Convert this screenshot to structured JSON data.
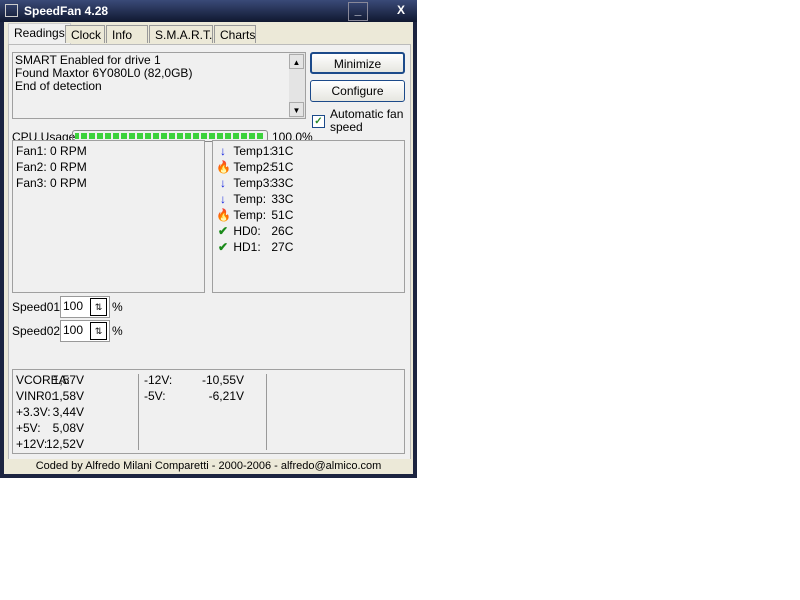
{
  "window": {
    "title": "SpeedFan 4.28",
    "minimize": "_",
    "close": "X"
  },
  "tabs": [
    {
      "label": "Readings"
    },
    {
      "label": "Clock"
    },
    {
      "label": "Info"
    },
    {
      "label": "S.M.A.R.T."
    },
    {
      "label": "Charts"
    }
  ],
  "log": [
    "SMART Enabled for drive 1",
    "Found Maxtor 6Y080L0 (82,0GB)",
    "End of detection"
  ],
  "buttons": {
    "minimize": "Minimize",
    "configure": "Configure"
  },
  "auto_fan": {
    "label_1": "Automatic fan",
    "label_2": "speed",
    "checked": true
  },
  "cpu": {
    "label": "CPU Usage",
    "value_text": "100,0%",
    "percent": 100
  },
  "fans": [
    "Fan1: 0 RPM",
    "Fan2: 0 RPM",
    "Fan3: 0 RPM"
  ],
  "temps": [
    {
      "icon": "arrow-down-icon",
      "label": "Temp1:",
      "value": "31C"
    },
    {
      "icon": "fire-icon",
      "label": "Temp2:",
      "value": "51C"
    },
    {
      "icon": "arrow-down-icon",
      "label": "Temp3:",
      "value": "33C"
    },
    {
      "icon": "arrow-down-icon",
      "label": "Temp:",
      "value": "33C"
    },
    {
      "icon": "fire-icon",
      "label": "Temp:",
      "value": "51C"
    },
    {
      "icon": "check-icon",
      "label": "HD0:",
      "value": "26C"
    },
    {
      "icon": "check-icon",
      "label": "HD1:",
      "value": "27C"
    }
  ],
  "speeds": [
    {
      "label": "Speed01:",
      "value": "100",
      "unit": "%"
    },
    {
      "label": "Speed02:",
      "value": "100",
      "unit": "%"
    }
  ],
  "volts_col1": [
    {
      "label": "VCOREA:",
      "value": "1,57V"
    },
    {
      "label": "VINR0:",
      "value": "1,58V"
    },
    {
      "label": "+3.3V:",
      "value": "3,44V"
    },
    {
      "label": "+5V:",
      "value": "5,08V"
    },
    {
      "label": "+12V:",
      "value": "12,52V"
    }
  ],
  "volts_col2": [
    {
      "label": "-12V:",
      "value": "-10,55V"
    },
    {
      "label": "-5V:",
      "value": "-6,21V"
    }
  ],
  "status": "Coded by Alfredo Milani Comparetti - 2000-2006 - alfredo@almico.com"
}
